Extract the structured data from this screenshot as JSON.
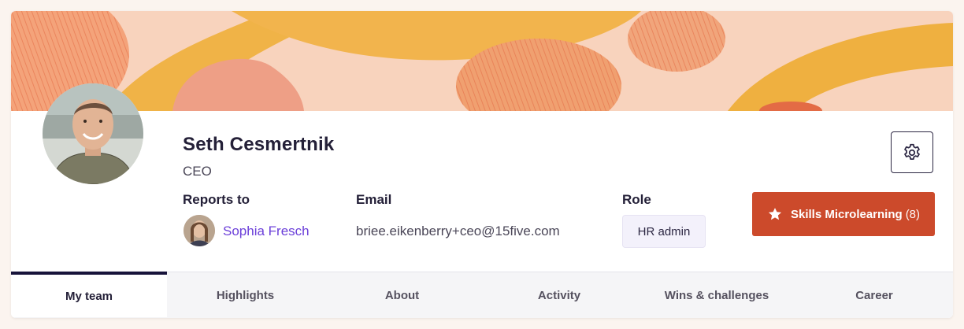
{
  "profile": {
    "name": "Seth Cesmertnik",
    "title": "CEO"
  },
  "reports_to": {
    "label": "Reports to",
    "manager_name": "Sophia Fresch"
  },
  "email": {
    "label": "Email",
    "value": "briee.eikenberry+ceo@15five.com"
  },
  "role": {
    "label": "Role",
    "value": "HR admin"
  },
  "actions": {
    "skills_label": "Skills Microlearning",
    "skills_count": "(8)",
    "settings_icon": "gear-icon",
    "skills_icon": "star-icon"
  },
  "tabs": [
    {
      "label": "My team",
      "active": true
    },
    {
      "label": "Highlights",
      "active": false
    },
    {
      "label": "About",
      "active": false
    },
    {
      "label": "Activity",
      "active": false
    },
    {
      "label": "Wins & challenges",
      "active": false
    },
    {
      "label": "Career",
      "active": false
    }
  ],
  "colors": {
    "accent": "#cc4a2b",
    "link": "#6b3fd9",
    "banner_bg": "#f8d3bd",
    "active_tab_indicator": "#17133a"
  }
}
